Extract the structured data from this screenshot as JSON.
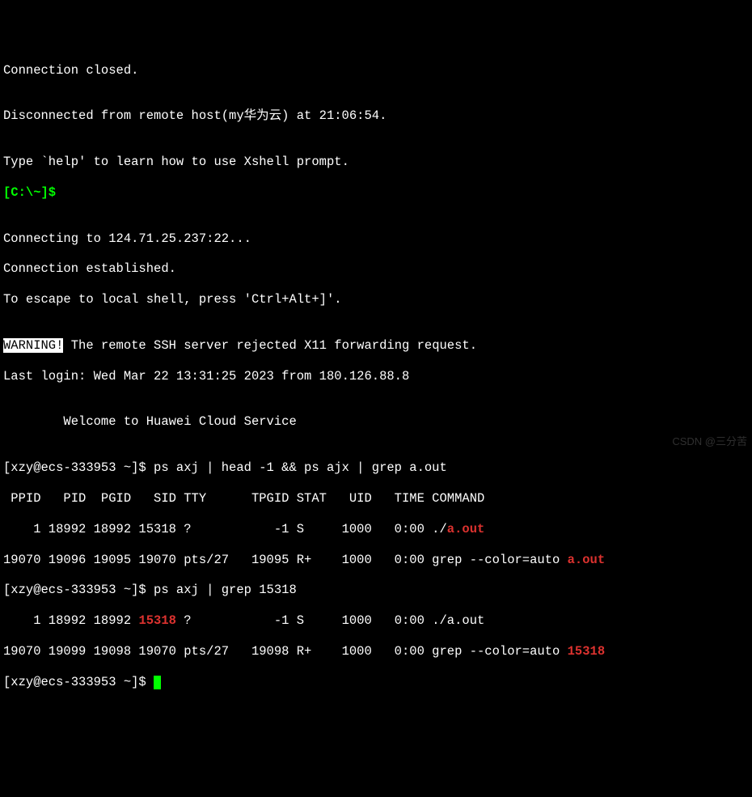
{
  "lines": {
    "l1": "Connection closed.",
    "l2": "",
    "l3": "Disconnected from remote host(my华为云) at 21:06:54.",
    "l4": "",
    "l5": "Type `help' to learn how to use Xshell prompt.",
    "l6a": "[C:\\~]$",
    "l7": "",
    "l8": "Connecting to 124.71.25.237:22...",
    "l9": "Connection established.",
    "l10": "To escape to local shell, press 'Ctrl+Alt+]'.",
    "l11": "",
    "l12a": "WARNING!",
    "l12b": " The remote SSH server rejected X11 forwarding request.",
    "l13": "Last login: Wed Mar 22 13:31:25 2023 from 180.126.88.8",
    "l14": "",
    "l15": "        Welcome to Huawei Cloud Service",
    "l16": "",
    "l17": "[xzy@ecs-333953 ~]$ ps axj | head -1 && ps ajx | grep a.out",
    "l18": " PPID   PID  PGID   SID TTY      TPGID STAT   UID   TIME COMMAND",
    "l19a": "    1 18992 18992 15318 ?           -1 S     1000   0:00 ./",
    "l19b": "a.out",
    "l20a": "19070 19096 19095 19070 pts/27   19095 R+    1000   0:00 grep --color=auto ",
    "l20b": "a.out",
    "l21": "[xzy@ecs-333953 ~]$ ps axj | grep 15318",
    "l22a": "    1 18992 18992 ",
    "l22b": "15318",
    "l22c": " ?           -1 S     1000   0:00 ./a.out",
    "l23a": "19070 19099 19098 19070 pts/27   19098 R+    1000   0:00 grep --color=auto ",
    "l23b": "15318",
    "l24": "[xzy@ecs-333953 ~]$ "
  },
  "watermark": "CSDN @三分苦"
}
